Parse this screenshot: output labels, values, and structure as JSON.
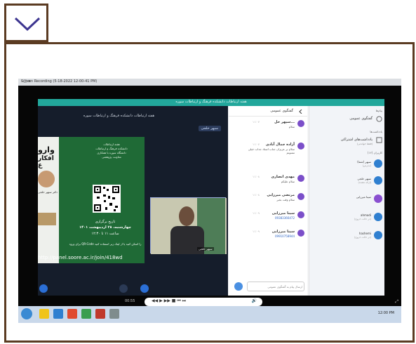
{
  "toggle": {
    "icon": "chevron-down-icon"
  },
  "recording": {
    "title": "Screen Recording (5-18-2022 12-00-41 PM)",
    "window_controls": "- □ ×",
    "maximize_glyph": "⤢"
  },
  "app": {
    "header_title": "هفته ارتباطات دانشکده فرهنگ و ارتباطات سوره",
    "stage_title": "هفته ارتباطات دانشکده فرهنگ و ارتباطات سوره",
    "speaker_chip": "سپهر خلجی",
    "slide": {
      "big_text_1": "وارو",
      "big_text_2": "افکار ع",
      "presenter_caption": "دکتر سپهر خلجی",
      "org_lines": [
        "هفته ارتباطات",
        "دانشکده فرهنگ و ارتباطات",
        "دانشگاه سوره با همکاری",
        "معاونت پژوهشی"
      ],
      "date_label": "تاریخ برگزاری",
      "date": "چهارشنبه، ۲۸ اردیبهشت ۱۴۰۱",
      "time": "ساعت ۱۱ تا ۱۲:۳۰",
      "qr_note": "برای ورود QR-Code را اسکن کنید یا از لینک زیر استفاده کنید",
      "link": "http://panel.soore.ac.ir/join/418wd"
    },
    "camera": {
      "name": "سپهر خلجی"
    },
    "chat": {
      "header": "گفتگوی عمومی",
      "messages": [
        {
          "name": "سپهر خل...",
          "time": "۱۱:۰۷",
          "text": "سلام",
          "color": "#7b4fc9"
        },
        {
          "name": "آزاده جمال آبادی",
          "time": "۱۱:۰۷",
          "text": "سلام بر عزیزان جناب استاد جداب خیلی ممنونم",
          "color": "#7b4fc9"
        },
        {
          "name": "مهدی انصاری",
          "time": "۱۱:۰۸",
          "text": "سلام علیکم",
          "color": "#7b4fc9"
        },
        {
          "name": "مرتضی میرزایی",
          "time": "۱۱:۰۸",
          "text": "سلام وقت بخیر",
          "color": "#7b4fc9"
        },
        {
          "name": "سینا میرزایی",
          "time": "۱۱:۰۹",
          "text": "09383366472",
          "color": "#7b4fc9"
        },
        {
          "name": "سینا میرزایی",
          "time": "۱۱:۰۹",
          "text": "09910758944",
          "color": "#7b4fc9"
        }
      ],
      "input_placeholder": "ارسال پیام به گفتگوی عمومی"
    },
    "side": {
      "section_messages": "پیام‌ها",
      "public_chat": "گفتگوی عمومی",
      "section_notes": "یادداشت‌ها",
      "shared_notes": "یادداشت‌های اشتراکی",
      "shared_notes_sub": "(فقط خواندنی)",
      "users_label": "کاربران (۱۲)",
      "users": [
        {
          "name": "سپهر (شما)",
          "sub": "(مدرس)",
          "color": "#2f7fd0"
        },
        {
          "name": "سپهر خلجی",
          "sub": "(ارائه دهنده)",
          "color": "#2f7fd0"
        },
        {
          "name": "سینا میرزایی",
          "sub": "",
          "color": "#8a4fd0"
        },
        {
          "name": "ahmadi",
          "sub": "(در حالت خروج)",
          "color": "#2f7fd0"
        },
        {
          "name": "hashemi",
          "sub": "(در حالت خروج)",
          "color": "#2f7fd0"
        }
      ]
    }
  },
  "media": {
    "time_elapsed": "00:55",
    "controls": "◀◀  ▶  ▶▶  ■  ⏮  ⏭",
    "volume": "🔊"
  },
  "taskbar": {
    "clock": "12:00 PM"
  }
}
